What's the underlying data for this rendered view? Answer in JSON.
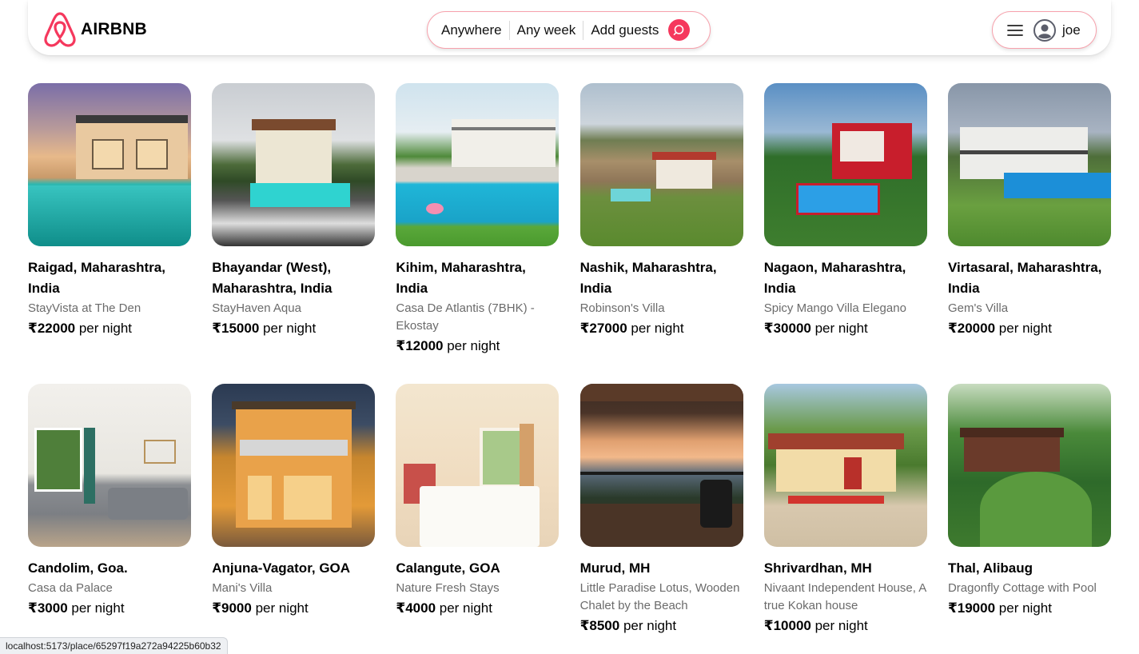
{
  "app": {
    "logo_text": "AIRBNB",
    "brand_color": "#f5385d"
  },
  "search": {
    "where": "Anywhere",
    "when": "Any week",
    "guests": "Add guests",
    "icon": "search-icon"
  },
  "user": {
    "name": "joe",
    "menu_icon": "hamburger-menu-icon",
    "avatar_icon": "user-circle-icon"
  },
  "listings": [
    {
      "title": "Raigad, Maharashtra, India",
      "subtitle": "StayVista at The Den",
      "price": "₹22000",
      "per": "per night"
    },
    {
      "title": "Bhayandar (West), Maharashtra, India",
      "subtitle": "StayHaven Aqua",
      "price": "₹15000",
      "per": "per night"
    },
    {
      "title": "Kihim, Maharashtra, India",
      "subtitle": "Casa De Atlantis (7BHK) - Ekostay",
      "price": "₹12000",
      "per": "per night"
    },
    {
      "title": "Nashik, Maharashtra, India",
      "subtitle": "Robinson's Villa",
      "price": "₹27000",
      "per": "per night"
    },
    {
      "title": "Nagaon, Maharashtra, India",
      "subtitle": "Spicy Mango Villa Elegano",
      "price": "₹30000",
      "per": "per night"
    },
    {
      "title": "Virtasaral, Maharashtra, India",
      "subtitle": "Gem's Villa",
      "price": "₹20000",
      "per": "per night"
    },
    {
      "title": "Candolim, Goa.",
      "subtitle": "Casa da Palace",
      "price": "₹3000",
      "per": "per night"
    },
    {
      "title": "Anjuna-Vagator, GOA",
      "subtitle": "Mani's Villa",
      "price": "₹9000",
      "per": "per night"
    },
    {
      "title": "Calangute, GOA",
      "subtitle": "Nature Fresh Stays",
      "price": "₹4000",
      "per": "per night"
    },
    {
      "title": "Murud, MH",
      "subtitle": "Little Paradise Lotus, Wooden Chalet by the Beach",
      "price": "₹8500",
      "per": "per night"
    },
    {
      "title": "Shrivardhan, MH",
      "subtitle": "Nivaant Independent House, A true Kokan house",
      "price": "₹10000",
      "per": "per night"
    },
    {
      "title": "Thal, Alibaug",
      "subtitle": "Dragonfly Cottage with Pool",
      "price": "₹19000",
      "per": "per night"
    }
  ],
  "status_url": "localhost:5173/place/65297f19a272a94225b60b32"
}
